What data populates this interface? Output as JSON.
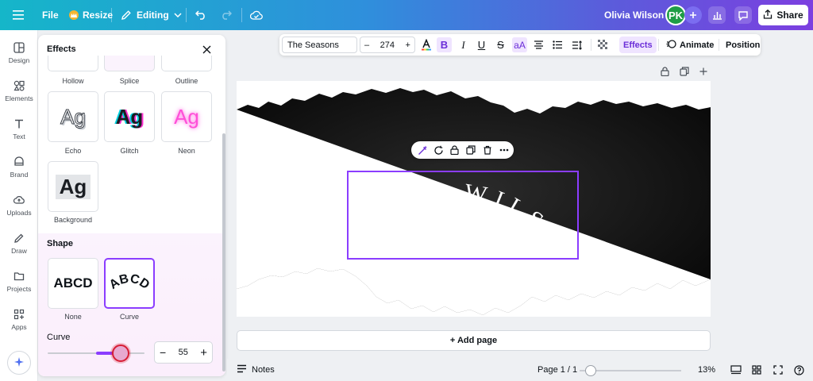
{
  "topbar": {
    "file_label": "File",
    "resize_label": "Resize",
    "editing_label": "Editing",
    "project_name": "Olivia Wilson",
    "avatar_initials": "PK",
    "share_label": "Share"
  },
  "rail": {
    "items": [
      {
        "label": "Design",
        "icon": "design-icon"
      },
      {
        "label": "Elements",
        "icon": "elements-icon"
      },
      {
        "label": "Text",
        "icon": "text-icon"
      },
      {
        "label": "Brand",
        "icon": "brand-icon"
      },
      {
        "label": "Uploads",
        "icon": "uploads-icon"
      },
      {
        "label": "Draw",
        "icon": "draw-icon"
      },
      {
        "label": "Projects",
        "icon": "projects-icon"
      },
      {
        "label": "Apps",
        "icon": "apps-icon"
      }
    ]
  },
  "panel": {
    "title": "Effects",
    "top_row": [
      "Hollow",
      "Splice",
      "Outline"
    ],
    "tiles": [
      {
        "label": "Echo",
        "sample": "Ag"
      },
      {
        "label": "Glitch",
        "sample": "Ag"
      },
      {
        "label": "Neon",
        "sample": "Ag"
      },
      {
        "label": "Background",
        "sample": "Ag"
      }
    ],
    "shape": {
      "title": "Shape",
      "options": [
        {
          "label": "None",
          "sample": "ABCD"
        },
        {
          "label": "Curve",
          "sample": "ABCD",
          "selected": true
        }
      ]
    },
    "curve": {
      "label": "Curve",
      "value": "55",
      "minus": "−",
      "plus": "+",
      "level": 0.75
    }
  },
  "toolbar": {
    "font": "The Seasons",
    "size": "274",
    "minus": "–",
    "plus": "+",
    "effects_label": "Effects",
    "animate_label": "Animate",
    "position_label": "Position"
  },
  "canvas": {
    "text": "OLIVIA WILSON",
    "add_page_label": "+ Add page"
  },
  "footer": {
    "notes_label": "Notes",
    "page_indicator": "Page 1 / 1",
    "zoom": "13%"
  },
  "colors": {
    "accent": "#8b3dff",
    "avatar": "#1f9d46",
    "slider_highlight": "#d61d35"
  }
}
